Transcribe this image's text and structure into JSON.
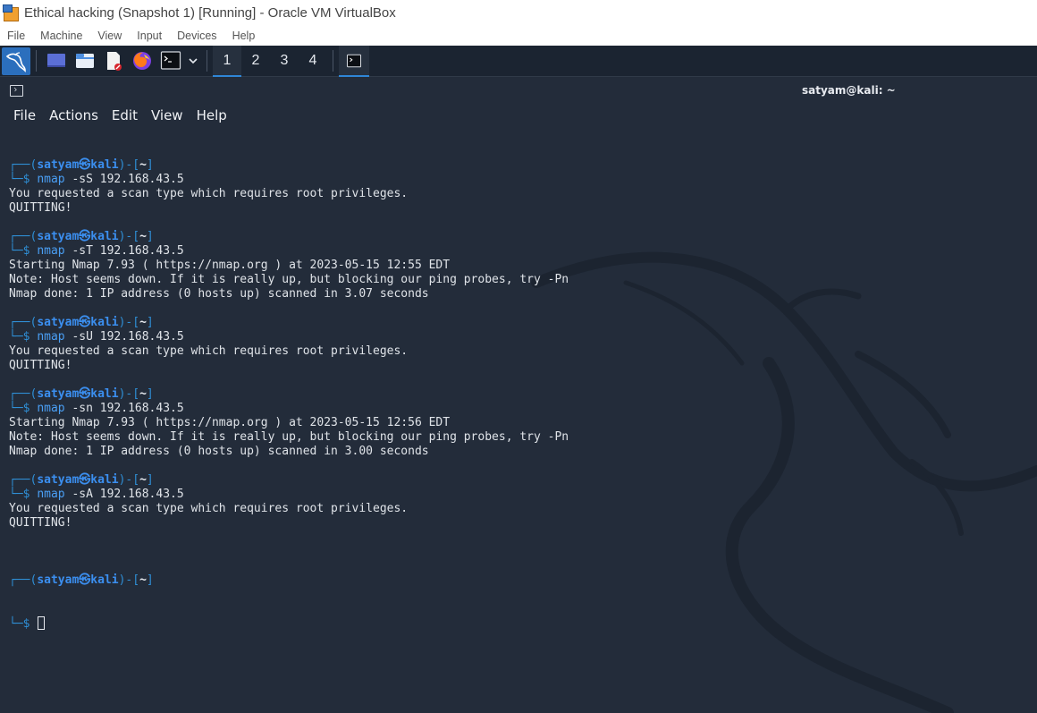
{
  "window": {
    "title": "Ethical hacking (Snapshot 1) [Running] - Oracle VM VirtualBox",
    "menu": [
      "File",
      "Machine",
      "View",
      "Input",
      "Devices",
      "Help"
    ]
  },
  "panel": {
    "workspaces": [
      "1",
      "2",
      "3",
      "4"
    ],
    "active_workspace": "1"
  },
  "terminal": {
    "title": "satyam@kali: ~",
    "menu": [
      "File",
      "Actions",
      "Edit",
      "View",
      "Help"
    ],
    "prompt": {
      "top_open": "┌──(",
      "user": "satyam㉿kali",
      "mid": ")-[",
      "path": "~",
      "close": "]",
      "bottom": "└─$ "
    },
    "blocks": [
      {
        "cmd": "nmap",
        "args": " -sS 192.168.43.5",
        "output": [
          "You requested a scan type which requires root privileges.",
          "QUITTING!"
        ]
      },
      {
        "cmd": "nmap",
        "args": " -sT 192.168.43.5",
        "output": [
          "Starting Nmap 7.93 ( https://nmap.org ) at 2023-05-15 12:55 EDT",
          "Note: Host seems down. If it is really up, but blocking our ping probes, try -Pn",
          "Nmap done: 1 IP address (0 hosts up) scanned in 3.07 seconds"
        ]
      },
      {
        "cmd": "nmap",
        "args": " -sU 192.168.43.5",
        "output": [
          "You requested a scan type which requires root privileges.",
          "QUITTING!"
        ]
      },
      {
        "cmd": "nmap",
        "args": " -sn 192.168.43.5",
        "output": [
          "Starting Nmap 7.93 ( https://nmap.org ) at 2023-05-15 12:56 EDT",
          "Note: Host seems down. If it is really up, but blocking our ping probes, try -Pn",
          "Nmap done: 1 IP address (0 hosts up) scanned in 3.00 seconds"
        ]
      },
      {
        "cmd": "nmap",
        "args": " -sA 192.168.43.5",
        "output": [
          "You requested a scan type which requires root privileges.",
          "QUITTING!"
        ]
      }
    ]
  },
  "colors": {
    "terminal_bg": "#232c3a",
    "panel_bg": "#1b2431",
    "accent": "#2f86d6",
    "prompt_user": "#3b8ff0"
  }
}
